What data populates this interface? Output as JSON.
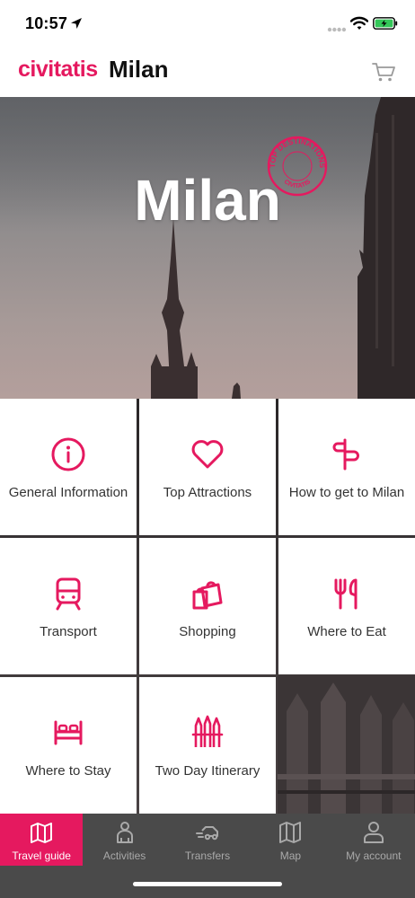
{
  "status_bar": {
    "time": "10:57",
    "icons": [
      "location-arrow-icon",
      "signal-dots-icon",
      "wifi-icon",
      "battery-charging-icon"
    ]
  },
  "header": {
    "brand": "civitatis",
    "city": "Milan",
    "cart_icon": "cart-icon"
  },
  "hero": {
    "title": "Milan",
    "badge_text": "TOP DESTINATIONS",
    "badge_brand": "CIVITATIS"
  },
  "menu": {
    "tiles": [
      {
        "label": "General Information",
        "icon": "info-icon"
      },
      {
        "label": "Top Attractions",
        "icon": "heart-icon"
      },
      {
        "label": "How to get to Milan",
        "icon": "signpost-icon"
      },
      {
        "label": "Transport",
        "icon": "train-icon"
      },
      {
        "label": "Shopping",
        "icon": "shopping-bags-icon"
      },
      {
        "label": "Where to Eat",
        "icon": "fork-knife-icon"
      },
      {
        "label": "Where to Stay",
        "icon": "bed-icon"
      },
      {
        "label": "Two Day Itinerary",
        "icon": "itinerary-icon"
      }
    ]
  },
  "tab_bar": {
    "tabs": [
      {
        "label": "Travel guide",
        "icon": "map-book-icon",
        "active": true
      },
      {
        "label": "Activities",
        "icon": "person-icon",
        "active": false
      },
      {
        "label": "Transfers",
        "icon": "transfer-car-icon",
        "active": false
      },
      {
        "label": "Map",
        "icon": "map-icon",
        "active": false
      },
      {
        "label": "My account",
        "icon": "user-icon",
        "active": false
      }
    ]
  },
  "colors": {
    "brand_accent": "#e5195f",
    "tab_bar_bg": "#4a4a4a",
    "tab_inactive": "#a9a9a9",
    "header_text": "#111111"
  }
}
